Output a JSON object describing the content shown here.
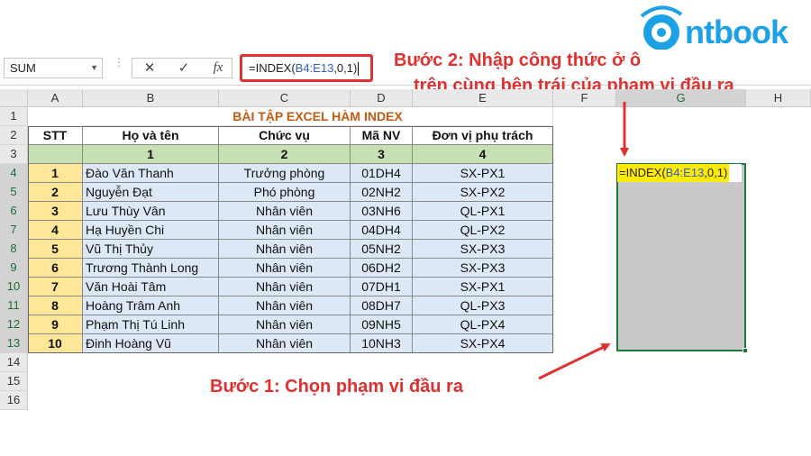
{
  "logo": {
    "text": "ntbook"
  },
  "formula_bar": {
    "name_box": "SUM",
    "cancel_icon": "✕",
    "enter_icon": "✓",
    "fx_label": "fx",
    "formula_prefix": "=INDEX(",
    "formula_ref": "B4:E13",
    "formula_suffix": ",0,1)"
  },
  "annotations": {
    "step2_line1": "Bước 2: Nhập công thức ở ô",
    "step2_line2": "trên cùng bên trái của phạm vi đầu ra",
    "step1": "Bước 1: Chọn phạm vi đầu ra"
  },
  "columns": [
    "A",
    "B",
    "C",
    "D",
    "E",
    "F",
    "G",
    "H"
  ],
  "rows": [
    "1",
    "2",
    "3",
    "4",
    "5",
    "6",
    "7",
    "8",
    "9",
    "10",
    "11",
    "12",
    "13",
    "14",
    "15",
    "16"
  ],
  "sheet": {
    "title": "BÀI TẬP EXCEL HÀM INDEX",
    "headers": [
      "STT",
      "Họ và tên",
      "Chức vụ",
      "Mã NV",
      "Đơn vị phụ trách"
    ],
    "index_row": [
      "1",
      "2",
      "3",
      "4"
    ],
    "data": [
      [
        "1",
        "Đào Văn Thanh",
        "Trưởng phòng",
        "01DH4",
        "SX-PX1"
      ],
      [
        "2",
        "Nguyễn Đạt",
        "Phó phòng",
        "02NH2",
        "SX-PX2"
      ],
      [
        "3",
        "Lưu Thùy Vân",
        "Nhân viên",
        "03NH6",
        "QL-PX1"
      ],
      [
        "4",
        "Hạ Huyền Chi",
        "Nhân viên",
        "04DH4",
        "QL-PX2"
      ],
      [
        "5",
        "Vũ Thị Thủy",
        "Nhân viên",
        "05NH2",
        "SX-PX3"
      ],
      [
        "6",
        "Trương Thành Long",
        "Nhân viên",
        "06DH2",
        "SX-PX3"
      ],
      [
        "7",
        "Văn Hoài Tâm",
        "Nhân viên",
        "07DH1",
        "SX-PX1"
      ],
      [
        "8",
        "Hoàng Trâm Anh",
        "Nhân viên",
        "08DH7",
        "QL-PX3"
      ],
      [
        "9",
        "Phạm Thị Tú Linh",
        "Nhân viên",
        "09NH5",
        "QL-PX4"
      ],
      [
        "10",
        "Đinh Hoàng Vũ",
        "Nhân viên",
        "10NH3",
        "SX-PX4"
      ]
    ],
    "g4_prefix": "=INDEX(",
    "g4_ref": "B4:E13",
    "g4_suffix": ",0,1)"
  },
  "colors": {
    "accent_red": "#e03131",
    "header_fill": "#ffffff",
    "index_fill": "#c6e0b4",
    "stt_fill": "#ffe699",
    "data_fill": "#dde8f6",
    "title_color": "#c55a11",
    "selection_border": "#1e7a3c",
    "logo_blue": "#1da1e6"
  }
}
